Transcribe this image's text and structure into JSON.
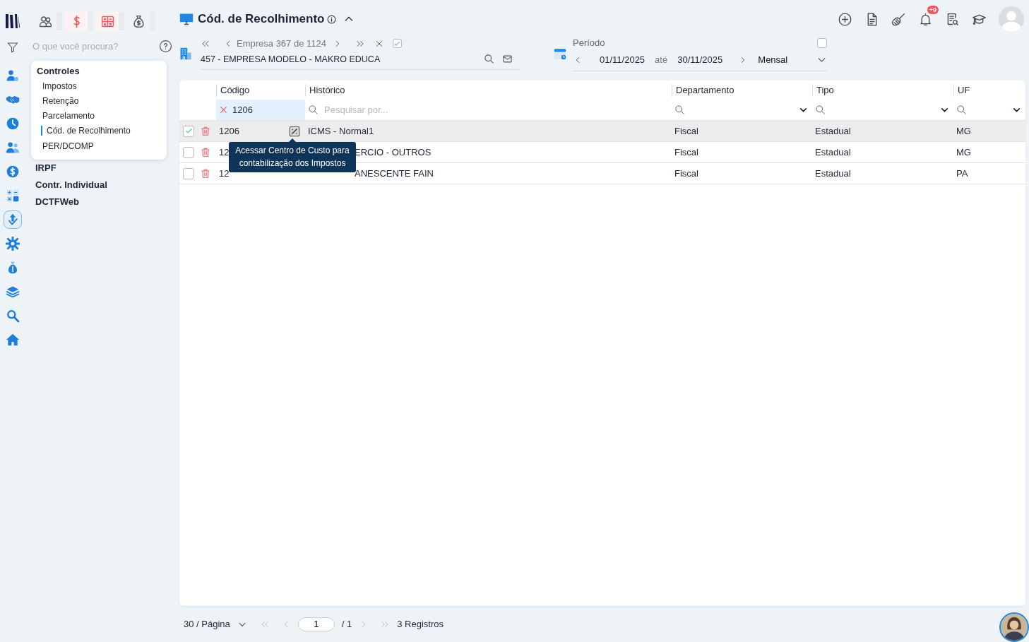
{
  "top_tabs": [
    {
      "kind": "people",
      "highlighted": false
    },
    {
      "kind": "dollar",
      "highlighted": true
    },
    {
      "kind": "calculator",
      "highlighted": true
    },
    {
      "kind": "moneybag",
      "highlighted": false
    }
  ],
  "search": {
    "placeholder": "O que você procura?"
  },
  "rail": [
    {
      "kind": "user-gear",
      "selected": false
    },
    {
      "kind": "handshake",
      "selected": false
    },
    {
      "kind": "clock",
      "selected": false
    },
    {
      "kind": "people",
      "selected": false
    },
    {
      "kind": "dollar",
      "selected": false
    },
    {
      "kind": "calculator",
      "selected": false
    },
    {
      "kind": "upload",
      "selected": true
    },
    {
      "kind": "gear",
      "selected": false
    },
    {
      "kind": "moneybag",
      "selected": false
    },
    {
      "kind": "layers",
      "selected": false
    },
    {
      "kind": "search",
      "selected": false
    },
    {
      "kind": "home",
      "selected": false
    }
  ],
  "nav": [
    {
      "label": "Controles",
      "expanded": true,
      "children": [
        {
          "label": "Impostos",
          "selected": false
        },
        {
          "label": "Retenção",
          "selected": false
        },
        {
          "label": "Parcelamento",
          "selected": false
        },
        {
          "label": "Cód. de Recolhimento",
          "selected": true
        },
        {
          "label": "PER/DCOMP",
          "selected": false
        }
      ]
    },
    {
      "label": "IRPF",
      "expanded": false
    },
    {
      "label": "Contr. Individual",
      "expanded": false
    },
    {
      "label": "DCTFWeb",
      "expanded": false
    }
  ],
  "page": {
    "title": "Cód. de Recolhimento",
    "expanded": true
  },
  "toolbar": {
    "notification_badge": "+9"
  },
  "company": {
    "position": "Empresa 367 de 1124",
    "name": "457 - EMPRESA MODELO - MAKRO EDUCA",
    "checked": true
  },
  "period": {
    "label": "Período",
    "start": "01/11/2025",
    "separator": "até",
    "end": "30/11/2025",
    "frequency": "Mensal",
    "checked": false
  },
  "table": {
    "columns": [
      "Código",
      "Histórico",
      "Departamento",
      "Tipo",
      "UF"
    ],
    "filters": [
      {
        "kind": "text",
        "value": "1206"
      },
      {
        "kind": "search",
        "placeholder": "Pesquisar por..."
      },
      {
        "kind": "select"
      },
      {
        "kind": "select"
      },
      {
        "kind": "select"
      }
    ],
    "rows": [
      {
        "selected": true,
        "cells": [
          "1206",
          "ICMS - Normal1",
          "Fiscal",
          "Estadual",
          "MG"
        ],
        "tooltip": "Acessar Centro de Custo para contabilização dos Impostos"
      },
      {
        "selected": false,
        "cells": [
          "12",
          "ERCIO - OUTROS",
          "Fiscal",
          "Estadual",
          "MG"
        ]
      },
      {
        "selected": false,
        "cells": [
          "12",
          "ANESCENTE FAIN",
          "Fiscal",
          "Estadual",
          "PA"
        ]
      }
    ]
  },
  "pagination": {
    "page_size": "30 / Página",
    "page": "1",
    "total_pages": "/ 1",
    "records": "3 Registros"
  }
}
